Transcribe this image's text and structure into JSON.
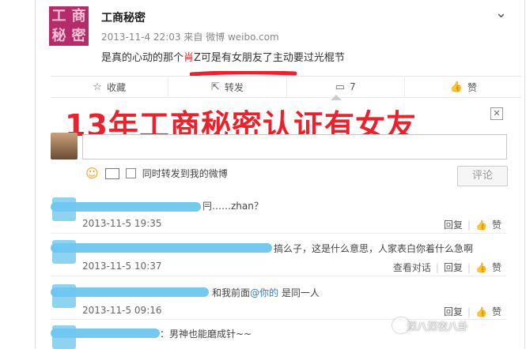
{
  "post": {
    "username": "工商秘密",
    "avatar_text": [
      "工",
      "商",
      "秘",
      "密"
    ],
    "meta": "2013-11-4 22:03 来自 微博 weibo.com",
    "text_before": "是真的心动的那个",
    "text_highlight": "肖",
    "text_after": "Z可是有女朋友了主动要过光棍节"
  },
  "actions": [
    {
      "icon": "star-icon",
      "glyph": "☆",
      "label": "收藏"
    },
    {
      "icon": "share-icon",
      "glyph": "⇱",
      "label": "转发"
    },
    {
      "icon": "comment-icon",
      "glyph": "▭",
      "label": "7"
    },
    {
      "icon": "thumbs-up-icon",
      "glyph": "👍",
      "label": "赞"
    }
  ],
  "overlay_title": "13年工商秘密认证有女友",
  "composer": {
    "also_repost_label": "同时转发到我的微博",
    "submit_label": "评论"
  },
  "comments": [
    {
      "text": "冃……zhan？",
      "time": "2013-11-5 19:35",
      "actions": [
        "回复",
        "赞"
      ],
      "extra": ""
    },
    {
      "text": "搞么子，这是什么意思，人家表白你着什么急啊",
      "time": "2013-11-5 10:37",
      "actions": [
        "回复",
        "赞"
      ],
      "extra": "查看对话"
    },
    {
      "text_before": "和我前面",
      "mention": "@你的",
      "text_after": " 是同一人",
      "time": "2013-11-5 09:16",
      "actions": [
        "回复",
        "赞"
      ],
      "extra": ""
    },
    {
      "text": "：男神也能磨成针~~",
      "time": "",
      "actions": [],
      "extra": ""
    }
  ],
  "watermark": "深八深夜八卦",
  "colors": {
    "overlay_red": "#e8232e",
    "mention_blue": "#3a78c2",
    "scribble_blue": "#6ec6ee"
  }
}
